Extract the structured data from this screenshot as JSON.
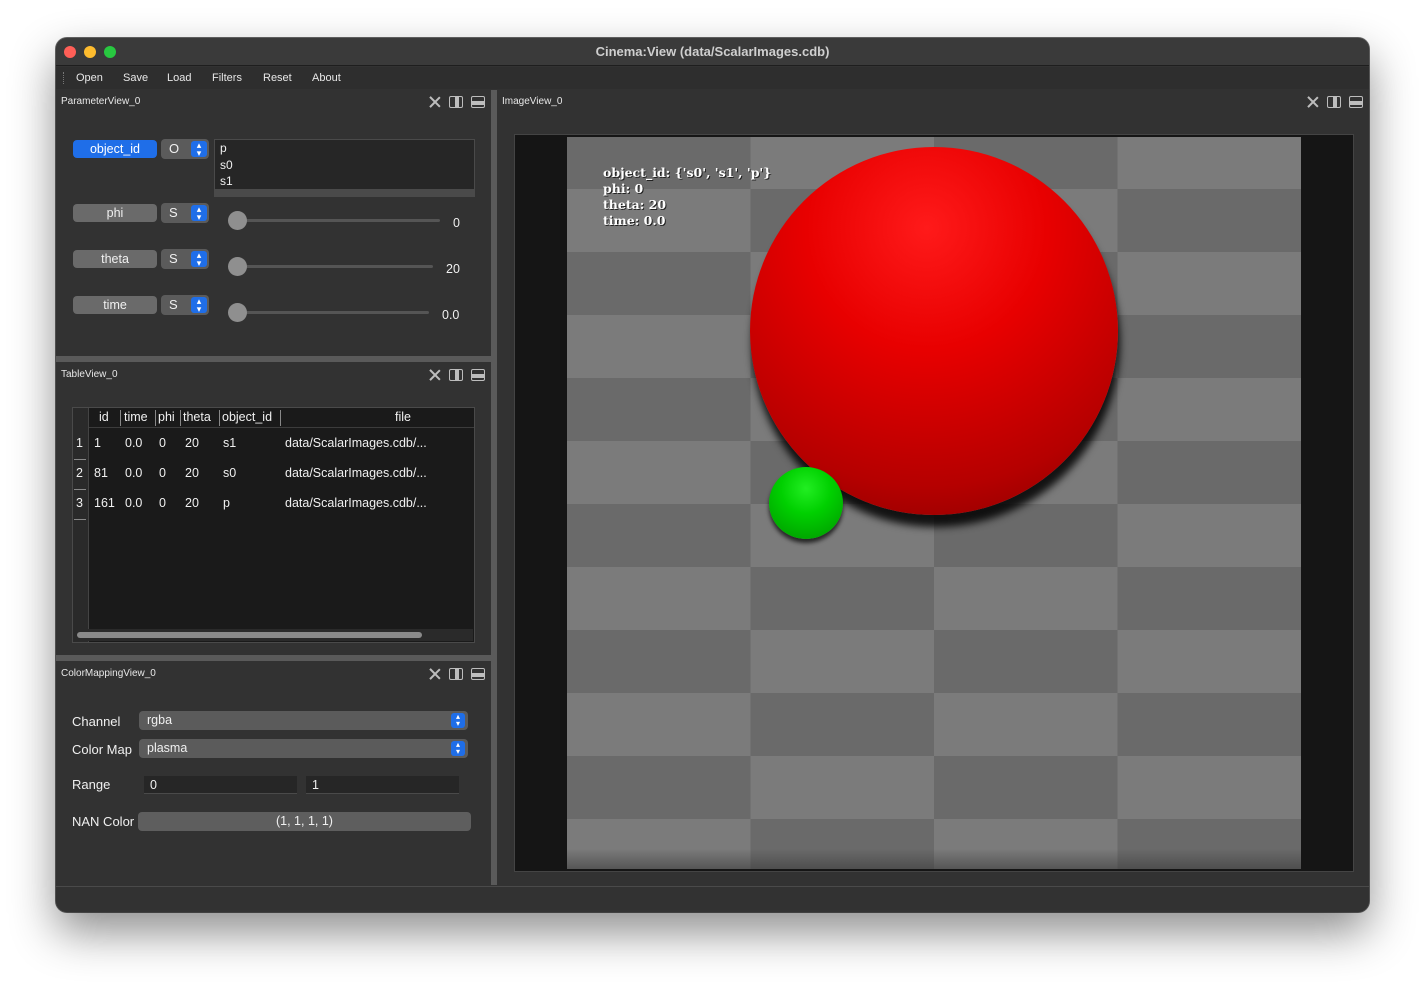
{
  "window": {
    "title": "Cinema:View (data/ScalarImages.cdb)"
  },
  "menu": {
    "items": [
      "Open",
      "Save",
      "Load",
      "Filters",
      "Reset",
      "About"
    ]
  },
  "parameter_view": {
    "title": "ParameterView_0",
    "params": [
      {
        "name": "object_id",
        "mode": "O",
        "active": true
      },
      {
        "name": "phi",
        "mode": "S",
        "value": "0"
      },
      {
        "name": "theta",
        "mode": "S",
        "value": "20"
      },
      {
        "name": "time",
        "mode": "S",
        "value": "0.0"
      }
    ],
    "object_list": [
      "p",
      "s0",
      "s1"
    ]
  },
  "table_view": {
    "title": "TableView_0",
    "columns": [
      "id",
      "time",
      "phi",
      "theta",
      "object_id",
      "file"
    ],
    "rows": [
      {
        "num": "1",
        "cells": [
          "1",
          "0.0",
          "0",
          "20",
          "s1",
          "data/ScalarImages.cdb/..."
        ]
      },
      {
        "num": "2",
        "cells": [
          "81",
          "0.0",
          "0",
          "20",
          "s0",
          "data/ScalarImages.cdb/..."
        ]
      },
      {
        "num": "3",
        "cells": [
          "161",
          "0.0",
          "0",
          "20",
          "p",
          "data/ScalarImages.cdb/..."
        ]
      }
    ]
  },
  "color_mapping_view": {
    "title": "ColorMappingView_0",
    "channel_label": "Channel",
    "channel_value": "rgba",
    "colormap_label": "Color Map",
    "colormap_value": "plasma",
    "range_label": "Range",
    "range_min": "0",
    "range_max": "1",
    "nan_label": "NAN Color",
    "nan_value": "(1, 1, 1, 1)"
  },
  "image_view": {
    "title": "ImageView_0",
    "overlay_lines": [
      "object_id: {'s0', 's1', 'p'}",
      "phi: 0",
      "theta: 20",
      "time: 0.0"
    ]
  },
  "colors": {
    "accent": "#1f6ee8",
    "sphere_red": "#e80000",
    "sphere_green": "#00d000"
  }
}
